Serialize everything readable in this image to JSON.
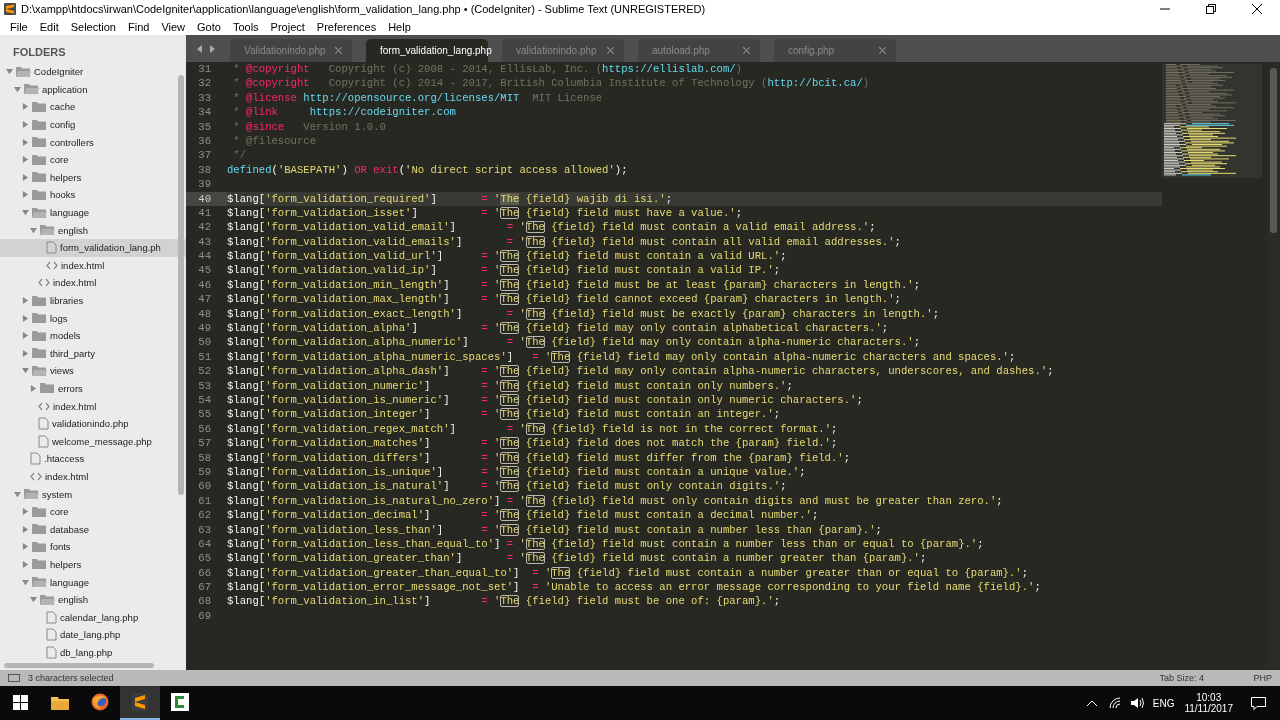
{
  "window": {
    "title": "D:\\xampp\\htdocs\\irwan\\CodeIgniter\\application\\language\\english\\form_validation_lang.php • (CodeIgniter) - Sublime Text (UNREGISTERED)"
  },
  "menu": [
    "File",
    "Edit",
    "Selection",
    "Find",
    "View",
    "Goto",
    "Tools",
    "Project",
    "Preferences",
    "Help"
  ],
  "sidebar": {
    "header": "FOLDERS",
    "items": [
      {
        "label": "CodeIgniter",
        "kind": "folder",
        "expanded": true,
        "selected": false,
        "children": [
          {
            "label": "application",
            "kind": "folder",
            "expanded": true,
            "selected": false,
            "children": [
              {
                "label": "cache",
                "kind": "folder",
                "expanded": false,
                "selected": false
              },
              {
                "label": "config",
                "kind": "folder",
                "expanded": false,
                "selected": false
              },
              {
                "label": "controllers",
                "kind": "folder",
                "expanded": false,
                "selected": false
              },
              {
                "label": "core",
                "kind": "folder",
                "expanded": false,
                "selected": false
              },
              {
                "label": "helpers",
                "kind": "folder",
                "expanded": false,
                "selected": false
              },
              {
                "label": "hooks",
                "kind": "folder",
                "expanded": false,
                "selected": false
              },
              {
                "label": "language",
                "kind": "folder",
                "expanded": true,
                "selected": false,
                "children": [
                  {
                    "label": "english",
                    "kind": "folder",
                    "expanded": true,
                    "selected": false,
                    "children": [
                      {
                        "label": "form_validation_lang.ph",
                        "kind": "file",
                        "selected": true
                      },
                      {
                        "label": "index.html",
                        "kind": "html",
                        "selected": false
                      }
                    ]
                  },
                  {
                    "label": "index.html",
                    "kind": "html",
                    "selected": false
                  }
                ]
              },
              {
                "label": "libraries",
                "kind": "folder",
                "expanded": false,
                "selected": false
              },
              {
                "label": "logs",
                "kind": "folder",
                "expanded": false,
                "selected": false
              },
              {
                "label": "models",
                "kind": "folder",
                "expanded": false,
                "selected": false
              },
              {
                "label": "third_party",
                "kind": "folder",
                "expanded": false,
                "selected": false
              },
              {
                "label": "views",
                "kind": "folder",
                "expanded": true,
                "selected": false,
                "children": [
                  {
                    "label": "errors",
                    "kind": "folder",
                    "expanded": false,
                    "selected": false
                  },
                  {
                    "label": "index.html",
                    "kind": "html",
                    "selected": false
                  },
                  {
                    "label": "validationindo.php",
                    "kind": "file",
                    "selected": false
                  },
                  {
                    "label": "welcome_message.php",
                    "kind": "file",
                    "selected": false
                  }
                ]
              },
              {
                "label": ".htaccess",
                "kind": "file",
                "selected": false
              },
              {
                "label": "index.html",
                "kind": "html",
                "selected": false
              }
            ]
          },
          {
            "label": "system",
            "kind": "folder",
            "expanded": true,
            "selected": false,
            "children": [
              {
                "label": "core",
                "kind": "folder",
                "expanded": false,
                "selected": false
              },
              {
                "label": "database",
                "kind": "folder",
                "expanded": false,
                "selected": false
              },
              {
                "label": "fonts",
                "kind": "folder",
                "expanded": false,
                "selected": false
              },
              {
                "label": "helpers",
                "kind": "folder",
                "expanded": false,
                "selected": false
              },
              {
                "label": "language",
                "kind": "folder",
                "expanded": true,
                "selected": false,
                "children": [
                  {
                    "label": "english",
                    "kind": "folder",
                    "expanded": true,
                    "selected": false,
                    "children": [
                      {
                        "label": "calendar_lang.php",
                        "kind": "file",
                        "selected": false
                      },
                      {
                        "label": "date_lang.php",
                        "kind": "file",
                        "selected": false
                      },
                      {
                        "label": "db_lang.php",
                        "kind": "file",
                        "selected": false
                      }
                    ]
                  }
                ]
              }
            ]
          }
        ]
      }
    ]
  },
  "tabs": [
    {
      "label": "Validationindo.php",
      "selected": false,
      "dirty": false
    },
    {
      "label": "form_validation_lang.php",
      "selected": true,
      "dirty": true
    },
    {
      "label": "validationindo.php",
      "selected": false,
      "dirty": false
    },
    {
      "label": "autoload.php",
      "selected": false,
      "dirty": false
    },
    {
      "label": "config.php",
      "selected": false,
      "dirty": false
    }
  ],
  "editor": {
    "lines": [
      {
        "n": "31",
        "current": false,
        "tokens": [
          {
            "t": " * ",
            "kind": "comment"
          },
          {
            "t": "@copyright",
            "kind": "tag"
          },
          {
            "t": "   Copyright (c) 2008 - 2014, EllisLab, Inc. (",
            "kind": "comment"
          },
          {
            "t": "https://ellislab.com/",
            "kind": "link"
          },
          {
            "t": ")",
            "kind": "comment"
          }
        ]
      },
      {
        "n": "32",
        "current": false,
        "tokens": [
          {
            "t": " * ",
            "kind": "comment"
          },
          {
            "t": "@copyright",
            "kind": "tag"
          },
          {
            "t": "   Copyright (c) 2014 - 2017, British Columbia Institute of Technology (",
            "kind": "comment"
          },
          {
            "t": "http://bcit.ca/",
            "kind": "link"
          },
          {
            "t": ")",
            "kind": "comment"
          }
        ]
      },
      {
        "n": "33",
        "current": false,
        "tokens": [
          {
            "t": " * ",
            "kind": "comment"
          },
          {
            "t": "@license ",
            "kind": "tag"
          },
          {
            "t": "http://opensource.org/licenses/MIT",
            "kind": "link"
          },
          {
            "t": "  MIT License",
            "kind": "comment"
          }
        ]
      },
      {
        "n": "34",
        "current": false,
        "tokens": [
          {
            "t": " * ",
            "kind": "comment"
          },
          {
            "t": "@link     ",
            "kind": "tag"
          },
          {
            "t": "https://codeigniter.com",
            "kind": "link"
          }
        ]
      },
      {
        "n": "35",
        "current": false,
        "tokens": [
          {
            "t": " * ",
            "kind": "comment"
          },
          {
            "t": "@since   ",
            "kind": "tag"
          },
          {
            "t": "Version 1.0.0",
            "kind": "comment"
          }
        ]
      },
      {
        "n": "36",
        "current": false,
        "tokens": [
          {
            "t": " * @filesource",
            "kind": "comment"
          }
        ]
      },
      {
        "n": "37",
        "current": false,
        "tokens": [
          {
            "t": " */",
            "kind": "comment"
          }
        ]
      },
      {
        "n": "38",
        "current": false,
        "tokens": [
          {
            "t": "defined",
            "kind": "func"
          },
          {
            "t": "(",
            "kind": "plain"
          },
          {
            "t": "'BASEPATH'",
            "kind": "str"
          },
          {
            "t": ") ",
            "kind": "plain"
          },
          {
            "t": "OR exit",
            "kind": "keyword"
          },
          {
            "t": "(",
            "kind": "plain"
          },
          {
            "t": "'No direct script access allowed'",
            "kind": "str"
          },
          {
            "t": ");",
            "kind": "plain"
          }
        ]
      },
      {
        "n": "39",
        "current": false
      },
      {
        "n": "40",
        "current": true,
        "tokens": [
          {
            "t": "$lang[",
            "kind": "plain"
          },
          {
            "t": "'form_validation_required'",
            "kind": "str"
          },
          {
            "t": "]       ",
            "kind": "plain"
          },
          {
            "t": "=",
            "kind": "op"
          },
          {
            "t": " '",
            "kind": "str"
          },
          {
            "t": "The",
            "kind": "selection"
          },
          {
            "t": " {field} wajib di isi.'",
            "kind": "str"
          },
          {
            "t": ";",
            "kind": "plain"
          }
        ]
      },
      {
        "n": "41",
        "current": false,
        "tokens": [
          {
            "t": "$lang[",
            "kind": "plain"
          },
          {
            "t": "'form_validation_isset'",
            "kind": "str"
          },
          {
            "t": "]          ",
            "kind": "plain"
          },
          {
            "t": "=",
            "kind": "op"
          },
          {
            "t": " '",
            "kind": "str"
          },
          {
            "t": "The",
            "kind": "match"
          },
          {
            "t": " {field} field must have a value.'",
            "kind": "str"
          },
          {
            "t": ";",
            "kind": "plain"
          }
        ]
      },
      {
        "n": "42",
        "current": false,
        "tokens": [
          {
            "t": "$lang[",
            "kind": "plain"
          },
          {
            "t": "'form_validation_valid_email'",
            "kind": "str"
          },
          {
            "t": "]        ",
            "kind": "plain"
          },
          {
            "t": "=",
            "kind": "op"
          },
          {
            "t": " '",
            "kind": "str"
          },
          {
            "t": "The",
            "kind": "match"
          },
          {
            "t": " {field} field must contain a valid email address.'",
            "kind": "str"
          },
          {
            "t": ";",
            "kind": "plain"
          }
        ]
      },
      {
        "n": "43",
        "current": false,
        "tokens": [
          {
            "t": "$lang[",
            "kind": "plain"
          },
          {
            "t": "'form_validation_valid_emails'",
            "kind": "str"
          },
          {
            "t": "]       ",
            "kind": "plain"
          },
          {
            "t": "=",
            "kind": "op"
          },
          {
            "t": " '",
            "kind": "str"
          },
          {
            "t": "The",
            "kind": "match"
          },
          {
            "t": " {field} field must contain all valid email addresses.'",
            "kind": "str"
          },
          {
            "t": ";",
            "kind": "plain"
          }
        ]
      },
      {
        "n": "44",
        "current": false,
        "tokens": [
          {
            "t": "$lang[",
            "kind": "plain"
          },
          {
            "t": "'form_validation_valid_url'",
            "kind": "str"
          },
          {
            "t": "]      ",
            "kind": "plain"
          },
          {
            "t": "=",
            "kind": "op"
          },
          {
            "t": " '",
            "kind": "str"
          },
          {
            "t": "The",
            "kind": "match"
          },
          {
            "t": " {field} field must contain a valid URL.'",
            "kind": "str"
          },
          {
            "t": ";",
            "kind": "plain"
          }
        ]
      },
      {
        "n": "45",
        "current": false,
        "tokens": [
          {
            "t": "$lang[",
            "kind": "plain"
          },
          {
            "t": "'form_validation_valid_ip'",
            "kind": "str"
          },
          {
            "t": "]       ",
            "kind": "plain"
          },
          {
            "t": "=",
            "kind": "op"
          },
          {
            "t": " '",
            "kind": "str"
          },
          {
            "t": "The",
            "kind": "match"
          },
          {
            "t": " {field} field must contain a valid IP.'",
            "kind": "str"
          },
          {
            "t": ";",
            "kind": "plain"
          }
        ]
      },
      {
        "n": "46",
        "current": false,
        "tokens": [
          {
            "t": "$lang[",
            "kind": "plain"
          },
          {
            "t": "'form_validation_min_length'",
            "kind": "str"
          },
          {
            "t": "]     ",
            "kind": "plain"
          },
          {
            "t": "=",
            "kind": "op"
          },
          {
            "t": " '",
            "kind": "str"
          },
          {
            "t": "The",
            "kind": "match"
          },
          {
            "t": " {field} field must be at least {param} characters in length.'",
            "kind": "str"
          },
          {
            "t": ";",
            "kind": "plain"
          }
        ]
      },
      {
        "n": "47",
        "current": false,
        "tokens": [
          {
            "t": "$lang[",
            "kind": "plain"
          },
          {
            "t": "'form_validation_max_length'",
            "kind": "str"
          },
          {
            "t": "]     ",
            "kind": "plain"
          },
          {
            "t": "=",
            "kind": "op"
          },
          {
            "t": " '",
            "kind": "str"
          },
          {
            "t": "The",
            "kind": "match"
          },
          {
            "t": " {field} field cannot exceed {param} characters in length.'",
            "kind": "str"
          },
          {
            "t": ";",
            "kind": "plain"
          }
        ]
      },
      {
        "n": "48",
        "current": false,
        "tokens": [
          {
            "t": "$lang[",
            "kind": "plain"
          },
          {
            "t": "'form_validation_exact_length'",
            "kind": "str"
          },
          {
            "t": "]       ",
            "kind": "plain"
          },
          {
            "t": "=",
            "kind": "op"
          },
          {
            "t": " '",
            "kind": "str"
          },
          {
            "t": "The",
            "kind": "match"
          },
          {
            "t": " {field} field must be exactly {param} characters in length.'",
            "kind": "str"
          },
          {
            "t": ";",
            "kind": "plain"
          }
        ]
      },
      {
        "n": "49",
        "current": false,
        "tokens": [
          {
            "t": "$lang[",
            "kind": "plain"
          },
          {
            "t": "'form_validation_alpha'",
            "kind": "str"
          },
          {
            "t": "]          ",
            "kind": "plain"
          },
          {
            "t": "=",
            "kind": "op"
          },
          {
            "t": " '",
            "kind": "str"
          },
          {
            "t": "The",
            "kind": "match"
          },
          {
            "t": " {field} field may only contain alphabetical characters.'",
            "kind": "str"
          },
          {
            "t": ";",
            "kind": "plain"
          }
        ]
      },
      {
        "n": "50",
        "current": false,
        "tokens": [
          {
            "t": "$lang[",
            "kind": "plain"
          },
          {
            "t": "'form_validation_alpha_numeric'",
            "kind": "str"
          },
          {
            "t": "]      ",
            "kind": "plain"
          },
          {
            "t": "=",
            "kind": "op"
          },
          {
            "t": " '",
            "kind": "str"
          },
          {
            "t": "The",
            "kind": "match"
          },
          {
            "t": " {field} field may only contain alpha-numeric characters.'",
            "kind": "str"
          },
          {
            "t": ";",
            "kind": "plain"
          }
        ]
      },
      {
        "n": "51",
        "current": false,
        "tokens": [
          {
            "t": "$lang[",
            "kind": "plain"
          },
          {
            "t": "'form_validation_alpha_numeric_spaces'",
            "kind": "str"
          },
          {
            "t": "]   ",
            "kind": "plain"
          },
          {
            "t": "=",
            "kind": "op"
          },
          {
            "t": " '",
            "kind": "str"
          },
          {
            "t": "The",
            "kind": "match"
          },
          {
            "t": " {field} field may only contain alpha-numeric characters and spaces.'",
            "kind": "str"
          },
          {
            "t": ";",
            "kind": "plain"
          }
        ]
      },
      {
        "n": "52",
        "current": false,
        "tokens": [
          {
            "t": "$lang[",
            "kind": "plain"
          },
          {
            "t": "'form_validation_alpha_dash'",
            "kind": "str"
          },
          {
            "t": "]     ",
            "kind": "plain"
          },
          {
            "t": "=",
            "kind": "op"
          },
          {
            "t": " '",
            "kind": "str"
          },
          {
            "t": "The",
            "kind": "match"
          },
          {
            "t": " {field} field may only contain alpha-numeric characters, underscores, and dashes.'",
            "kind": "str"
          },
          {
            "t": ";",
            "kind": "plain"
          }
        ]
      },
      {
        "n": "53",
        "current": false,
        "tokens": [
          {
            "t": "$lang[",
            "kind": "plain"
          },
          {
            "t": "'form_validation_numeric'",
            "kind": "str"
          },
          {
            "t": "]        ",
            "kind": "plain"
          },
          {
            "t": "=",
            "kind": "op"
          },
          {
            "t": " '",
            "kind": "str"
          },
          {
            "t": "The",
            "kind": "match"
          },
          {
            "t": " {field} field must contain only numbers.'",
            "kind": "str"
          },
          {
            "t": ";",
            "kind": "plain"
          }
        ]
      },
      {
        "n": "54",
        "current": false,
        "tokens": [
          {
            "t": "$lang[",
            "kind": "plain"
          },
          {
            "t": "'form_validation_is_numeric'",
            "kind": "str"
          },
          {
            "t": "]     ",
            "kind": "plain"
          },
          {
            "t": "=",
            "kind": "op"
          },
          {
            "t": " '",
            "kind": "str"
          },
          {
            "t": "The",
            "kind": "match"
          },
          {
            "t": " {field} field must contain only numeric characters.'",
            "kind": "str"
          },
          {
            "t": ";",
            "kind": "plain"
          }
        ]
      },
      {
        "n": "55",
        "current": false,
        "tokens": [
          {
            "t": "$lang[",
            "kind": "plain"
          },
          {
            "t": "'form_validation_integer'",
            "kind": "str"
          },
          {
            "t": "]        ",
            "kind": "plain"
          },
          {
            "t": "=",
            "kind": "op"
          },
          {
            "t": " '",
            "kind": "str"
          },
          {
            "t": "The",
            "kind": "match"
          },
          {
            "t": " {field} field must contain an integer.'",
            "kind": "str"
          },
          {
            "t": ";",
            "kind": "plain"
          }
        ]
      },
      {
        "n": "56",
        "current": false,
        "tokens": [
          {
            "t": "$lang[",
            "kind": "plain"
          },
          {
            "t": "'form_validation_regex_match'",
            "kind": "str"
          },
          {
            "t": "]        ",
            "kind": "plain"
          },
          {
            "t": "=",
            "kind": "op"
          },
          {
            "t": " '",
            "kind": "str"
          },
          {
            "t": "The",
            "kind": "match"
          },
          {
            "t": " {field} field is not in the correct format.'",
            "kind": "str"
          },
          {
            "t": ";",
            "kind": "plain"
          }
        ]
      },
      {
        "n": "57",
        "current": false,
        "tokens": [
          {
            "t": "$lang[",
            "kind": "plain"
          },
          {
            "t": "'form_validation_matches'",
            "kind": "str"
          },
          {
            "t": "]        ",
            "kind": "plain"
          },
          {
            "t": "=",
            "kind": "op"
          },
          {
            "t": " '",
            "kind": "str"
          },
          {
            "t": "The",
            "kind": "match"
          },
          {
            "t": " {field} field does not match the {param} field.'",
            "kind": "str"
          },
          {
            "t": ";",
            "kind": "plain"
          }
        ]
      },
      {
        "n": "58",
        "current": false,
        "tokens": [
          {
            "t": "$lang[",
            "kind": "plain"
          },
          {
            "t": "'form_validation_differs'",
            "kind": "str"
          },
          {
            "t": "]        ",
            "kind": "plain"
          },
          {
            "t": "=",
            "kind": "op"
          },
          {
            "t": " '",
            "kind": "str"
          },
          {
            "t": "The",
            "kind": "match"
          },
          {
            "t": " {field} field must differ from the {param} field.'",
            "kind": "str"
          },
          {
            "t": ";",
            "kind": "plain"
          }
        ]
      },
      {
        "n": "59",
        "current": false,
        "tokens": [
          {
            "t": "$lang[",
            "kind": "plain"
          },
          {
            "t": "'form_validation_is_unique'",
            "kind": "str"
          },
          {
            "t": "]      ",
            "kind": "plain"
          },
          {
            "t": "=",
            "kind": "op"
          },
          {
            "t": " '",
            "kind": "str"
          },
          {
            "t": "The",
            "kind": "match"
          },
          {
            "t": " {field} field must contain a unique value.'",
            "kind": "str"
          },
          {
            "t": ";",
            "kind": "plain"
          }
        ]
      },
      {
        "n": "60",
        "current": false,
        "tokens": [
          {
            "t": "$lang[",
            "kind": "plain"
          },
          {
            "t": "'form_validation_is_natural'",
            "kind": "str"
          },
          {
            "t": "]     ",
            "kind": "plain"
          },
          {
            "t": "=",
            "kind": "op"
          },
          {
            "t": " '",
            "kind": "str"
          },
          {
            "t": "The",
            "kind": "match"
          },
          {
            "t": " {field} field must only contain digits.'",
            "kind": "str"
          },
          {
            "t": ";",
            "kind": "plain"
          }
        ]
      },
      {
        "n": "61",
        "current": false,
        "tokens": [
          {
            "t": "$lang[",
            "kind": "plain"
          },
          {
            "t": "'form_validation_is_natural_no_zero'",
            "kind": "str"
          },
          {
            "t": "] ",
            "kind": "plain"
          },
          {
            "t": "=",
            "kind": "op"
          },
          {
            "t": " '",
            "kind": "str"
          },
          {
            "t": "The",
            "kind": "match"
          },
          {
            "t": " {field} field must only contain digits and must be greater than zero.'",
            "kind": "str"
          },
          {
            "t": ";",
            "kind": "plain"
          }
        ]
      },
      {
        "n": "62",
        "current": false,
        "tokens": [
          {
            "t": "$lang[",
            "kind": "plain"
          },
          {
            "t": "'form_validation_decimal'",
            "kind": "str"
          },
          {
            "t": "]        ",
            "kind": "plain"
          },
          {
            "t": "=",
            "kind": "op"
          },
          {
            "t": " '",
            "kind": "str"
          },
          {
            "t": "The",
            "kind": "match"
          },
          {
            "t": " {field} field must contain a decimal number.'",
            "kind": "str"
          },
          {
            "t": ";",
            "kind": "plain"
          }
        ]
      },
      {
        "n": "63",
        "current": false,
        "tokens": [
          {
            "t": "$lang[",
            "kind": "plain"
          },
          {
            "t": "'form_validation_less_than'",
            "kind": "str"
          },
          {
            "t": "]      ",
            "kind": "plain"
          },
          {
            "t": "=",
            "kind": "op"
          },
          {
            "t": " '",
            "kind": "str"
          },
          {
            "t": "The",
            "kind": "match"
          },
          {
            "t": " {field} field must contain a number less than {param}.'",
            "kind": "str"
          },
          {
            "t": ";",
            "kind": "plain"
          }
        ]
      },
      {
        "n": "64",
        "current": false,
        "tokens": [
          {
            "t": "$lang[",
            "kind": "plain"
          },
          {
            "t": "'form_validation_less_than_equal_to'",
            "kind": "str"
          },
          {
            "t": "] ",
            "kind": "plain"
          },
          {
            "t": "=",
            "kind": "op"
          },
          {
            "t": " '",
            "kind": "str"
          },
          {
            "t": "The",
            "kind": "match"
          },
          {
            "t": " {field} field must contain a number less than or equal to {param}.'",
            "kind": "str"
          },
          {
            "t": ";",
            "kind": "plain"
          }
        ]
      },
      {
        "n": "65",
        "current": false,
        "tokens": [
          {
            "t": "$lang[",
            "kind": "plain"
          },
          {
            "t": "'form_validation_greater_than'",
            "kind": "str"
          },
          {
            "t": "]       ",
            "kind": "plain"
          },
          {
            "t": "=",
            "kind": "op"
          },
          {
            "t": " '",
            "kind": "str"
          },
          {
            "t": "The",
            "kind": "match"
          },
          {
            "t": " {field} field must contain a number greater than {param}.'",
            "kind": "str"
          },
          {
            "t": ";",
            "kind": "plain"
          }
        ]
      },
      {
        "n": "66",
        "current": false,
        "tokens": [
          {
            "t": "$lang[",
            "kind": "plain"
          },
          {
            "t": "'form_validation_greater_than_equal_to'",
            "kind": "str"
          },
          {
            "t": "]  ",
            "kind": "plain"
          },
          {
            "t": "=",
            "kind": "op"
          },
          {
            "t": " '",
            "kind": "str"
          },
          {
            "t": "The",
            "kind": "match"
          },
          {
            "t": " {field} field must contain a number greater than or equal to {param}.'",
            "kind": "str"
          },
          {
            "t": ";",
            "kind": "plain"
          }
        ]
      },
      {
        "n": "67",
        "current": false,
        "tokens": [
          {
            "t": "$lang[",
            "kind": "plain"
          },
          {
            "t": "'form_validation_error_message_not_set'",
            "kind": "str"
          },
          {
            "t": "]  ",
            "kind": "plain"
          },
          {
            "t": "=",
            "kind": "op"
          },
          {
            "t": " 'Unable to access an error message corresponding to your field name {field}.'",
            "kind": "str"
          },
          {
            "t": ";",
            "kind": "plain"
          }
        ]
      },
      {
        "n": "68",
        "current": false,
        "tokens": [
          {
            "t": "$lang[",
            "kind": "plain"
          },
          {
            "t": "'form_validation_in_list'",
            "kind": "str"
          },
          {
            "t": "]        ",
            "kind": "plain"
          },
          {
            "t": "=",
            "kind": "op"
          },
          {
            "t": " '",
            "kind": "str"
          },
          {
            "t": "The",
            "kind": "match"
          },
          {
            "t": " {field} field must be one of: {param}.'",
            "kind": "str"
          },
          {
            "t": ";",
            "kind": "plain"
          }
        ]
      },
      {
        "n": "69",
        "current": false
      }
    ]
  },
  "status_bar": {
    "message": "3 characters selected",
    "tab_size": "Tab Size: 4",
    "syntax": "PHP"
  },
  "taskbar": {
    "apps": [
      {
        "kind": "files",
        "active": false
      },
      {
        "kind": "browser",
        "active": false
      },
      {
        "kind": "sublime",
        "active": true
      },
      {
        "kind": "recorder",
        "active": false
      }
    ],
    "language": "ENG",
    "time": "10:03",
    "date": "11/11/2017"
  }
}
